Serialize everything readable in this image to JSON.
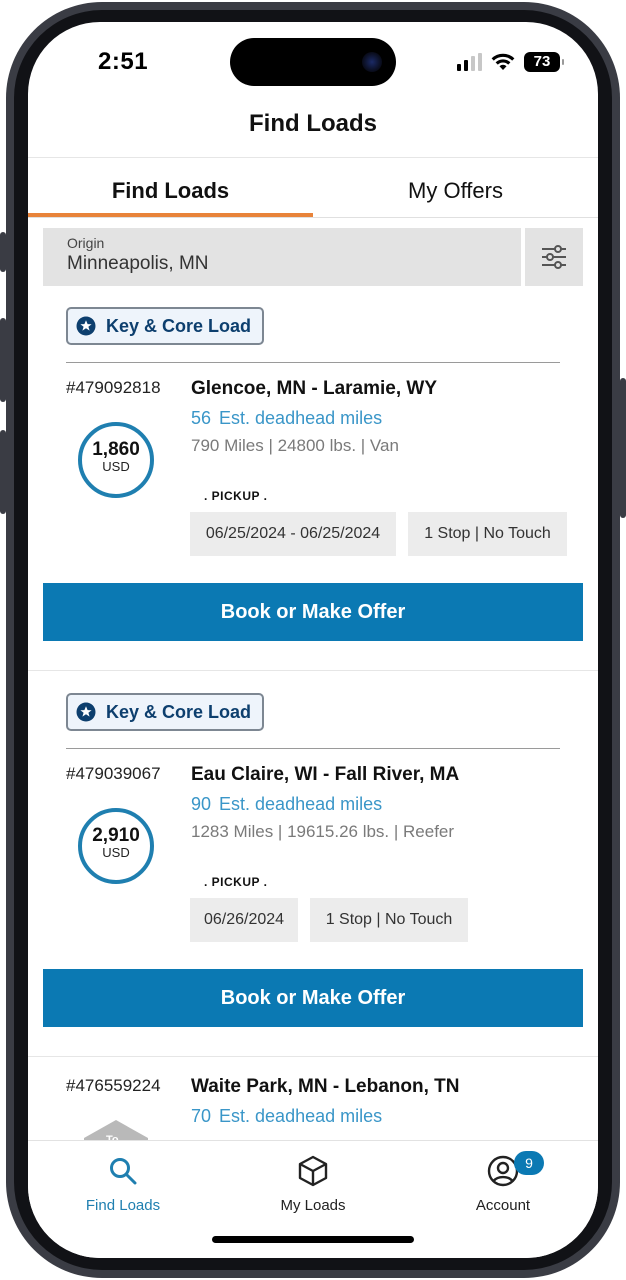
{
  "status": {
    "time": "2:51",
    "battery": "73"
  },
  "header": {
    "title": "Find Loads"
  },
  "tabs": [
    {
      "label": "Find Loads",
      "active": true
    },
    {
      "label": "My Offers",
      "active": false
    }
  ],
  "search": {
    "origin_label": "Origin",
    "origin_value": "Minneapolis, MN",
    "filter_icon": "sliders-icon"
  },
  "loads": [
    {
      "badge": "Key & Core Load",
      "id": "#479092818",
      "route": "Glencoe, MN - Laramie, WY",
      "deadhead_miles": "56",
      "deadhead_label": "Est. deadhead miles",
      "specs": "790 Miles | 24800 lbs. | Van",
      "price": "1,860",
      "currency": "USD",
      "pickup_label": ". PICKUP .",
      "pickup_dates": "06/25/2024 - 06/25/2024",
      "stops": "1 Stop | No Touch",
      "button": "Book or Make Offer"
    },
    {
      "badge": "Key & Core Load",
      "id": "#479039067",
      "route": "Eau Claire, WI - Fall River, MA",
      "deadhead_miles": "90",
      "deadhead_label": "Est. deadhead miles",
      "specs": "1283 Miles | 19615.26 lbs. | Reefer",
      "price": "2,910",
      "currency": "USD",
      "pickup_label": ". PICKUP .",
      "pickup_dates": "06/26/2024",
      "stops": "1 Stop | No Touch",
      "button": "Book or Make Offer"
    },
    {
      "id": "#476559224",
      "route": "Waite Park, MN - Lebanon, TN",
      "deadhead_miles": "70",
      "deadhead_label": "Est. deadhead miles",
      "icon_text": "To"
    }
  ],
  "bottom_nav": [
    {
      "label": "Find Loads",
      "icon": "search-icon",
      "active": true
    },
    {
      "label": "My Loads",
      "icon": "box-icon",
      "active": false
    },
    {
      "label": "Account",
      "icon": "account-icon",
      "active": false,
      "badge": "9"
    }
  ],
  "colors": {
    "accent": "#0b79b3",
    "tab_underline": "#e8833a",
    "deadhead": "#3a96c8"
  }
}
